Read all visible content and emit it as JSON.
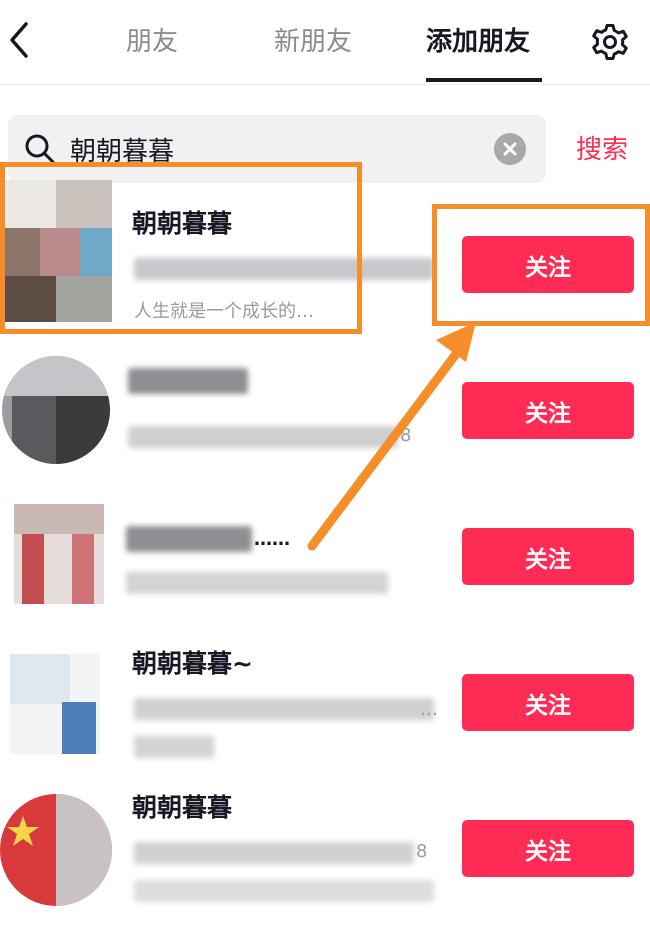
{
  "header": {
    "back_icon": "chevron-left-icon",
    "tabs": [
      {
        "label": "朋友",
        "active": false
      },
      {
        "label": "新朋友",
        "active": false
      },
      {
        "label": "添加朋友",
        "active": true
      }
    ],
    "settings_icon": "gear-icon"
  },
  "search": {
    "value": "朝朝暮暮",
    "search_icon": "search-icon",
    "clear_icon": "clear-icon",
    "submit_label": "搜索"
  },
  "results": [
    {
      "name": "朝朝暮暮",
      "sub_text": "人生就是一个成长的…",
      "follow_label": "关注"
    },
    {
      "name": "",
      "sub_text": "8",
      "follow_label": "关注"
    },
    {
      "name": "",
      "sub_text": "……",
      "follow_label": "关注"
    },
    {
      "name": "朝朝暮暮~",
      "sub_text": "…",
      "follow_label": "关注"
    },
    {
      "name": "朝朝暮暮",
      "sub_text": "8",
      "follow_label": "关注"
    }
  ],
  "colors": {
    "accent": "#fe2c55",
    "annotation": "#f58d2b",
    "text_primary": "#161823",
    "text_secondary": "#8a8b91",
    "search_bg": "#f1f1f2"
  }
}
